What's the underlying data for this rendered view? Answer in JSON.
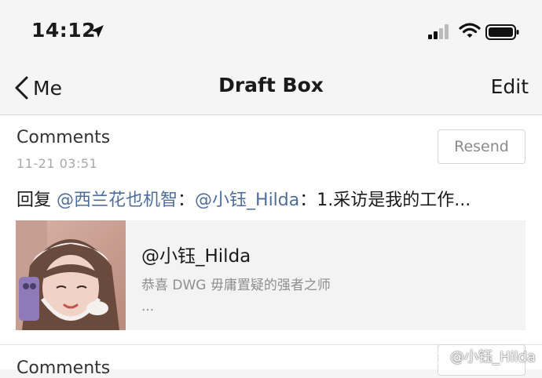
{
  "status_bar": {
    "time": "14:12"
  },
  "nav": {
    "back_label": "Me",
    "title": "Draft Box",
    "edit_label": "Edit"
  },
  "drafts": [
    {
      "type": "Comments",
      "time": "11-21 03:51",
      "resend_label": "Resend",
      "text_prefix": "回复 ",
      "mention1": "@西兰花也机智",
      "sep1": "：",
      "mention2": "@小钰_Hilda",
      "sep2": "：",
      "text_body": "1.采访是我的工作...",
      "quote": {
        "author": "@小钰_Hilda",
        "text": "恭喜 DWG   毋庸置疑的强者之师",
        "ellipsis": "..."
      }
    },
    {
      "type": "Comments"
    }
  ],
  "watermark": {
    "text": "@小钰_Hilda"
  },
  "colors": {
    "mention": "#4f6d9a",
    "background": "#f5f5f5",
    "card": "#f3f3f3"
  }
}
